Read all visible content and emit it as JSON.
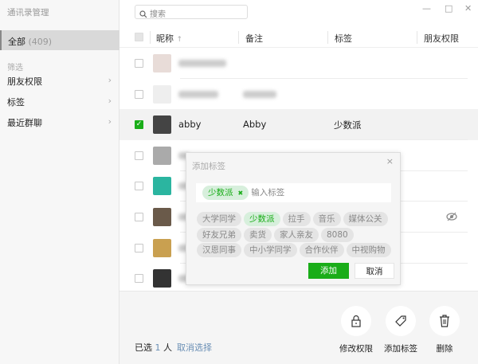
{
  "app_title": "通讯录管理",
  "sidebar": {
    "all_label": "全部",
    "all_count": "(409)",
    "filter_heading": "筛选",
    "items": [
      {
        "label": "朋友权限"
      },
      {
        "label": "标签"
      },
      {
        "label": "最近群聊"
      }
    ],
    "chevron": "›"
  },
  "search": {
    "placeholder": "搜索"
  },
  "window": {
    "minimize": "—",
    "maximize": "□",
    "close": "✕"
  },
  "table": {
    "headers": {
      "nickname": "昵称",
      "sort_arrow": "↑",
      "remark": "备注",
      "tag": "标签",
      "permission": "朋友权限"
    },
    "rows": [
      {
        "checked": false,
        "blurred": true
      },
      {
        "checked": false,
        "blurred": true
      },
      {
        "checked": true,
        "nickname": "abby",
        "remark": "Abby",
        "tag": "少数派"
      },
      {
        "checked": false,
        "blurred": true
      },
      {
        "checked": false,
        "blurred": true
      },
      {
        "checked": false,
        "blurred": true,
        "permission_icon": "eye-hidden-icon"
      },
      {
        "checked": false,
        "blurred": true
      },
      {
        "checked": false,
        "blurred": true
      }
    ]
  },
  "bottom": {
    "selected_prefix": "已选",
    "selected_count": "1",
    "selected_suffix": "人",
    "deselect": "取消选择",
    "actions": [
      {
        "label": "修改权限",
        "icon": "lock-icon"
      },
      {
        "label": "添加标签",
        "icon": "tag-icon"
      },
      {
        "label": "删除",
        "icon": "trash-icon"
      }
    ]
  },
  "dialog": {
    "title": "添加标签",
    "close": "×",
    "selected_tag": "少数派",
    "input_placeholder": "输入标签",
    "tags": [
      {
        "label": "大学同学",
        "on": false
      },
      {
        "label": "少数派",
        "on": true
      },
      {
        "label": "拉手",
        "on": false
      },
      {
        "label": "音乐",
        "on": false
      },
      {
        "label": "媒体公关",
        "on": false
      },
      {
        "label": "好友兄弟",
        "on": false
      },
      {
        "label": "卖货",
        "on": false
      },
      {
        "label": "家人亲友",
        "on": false
      },
      {
        "label": "8080",
        "on": false
      },
      {
        "label": "汉恩同事",
        "on": false
      },
      {
        "label": "中小学同学",
        "on": false
      },
      {
        "label": "合作伙伴",
        "on": false
      },
      {
        "label": "中视购物",
        "on": false
      }
    ],
    "ok": "添加",
    "cancel": "取消"
  },
  "colors": {
    "accent": "#1aad19",
    "link": "#6a8fb5"
  }
}
